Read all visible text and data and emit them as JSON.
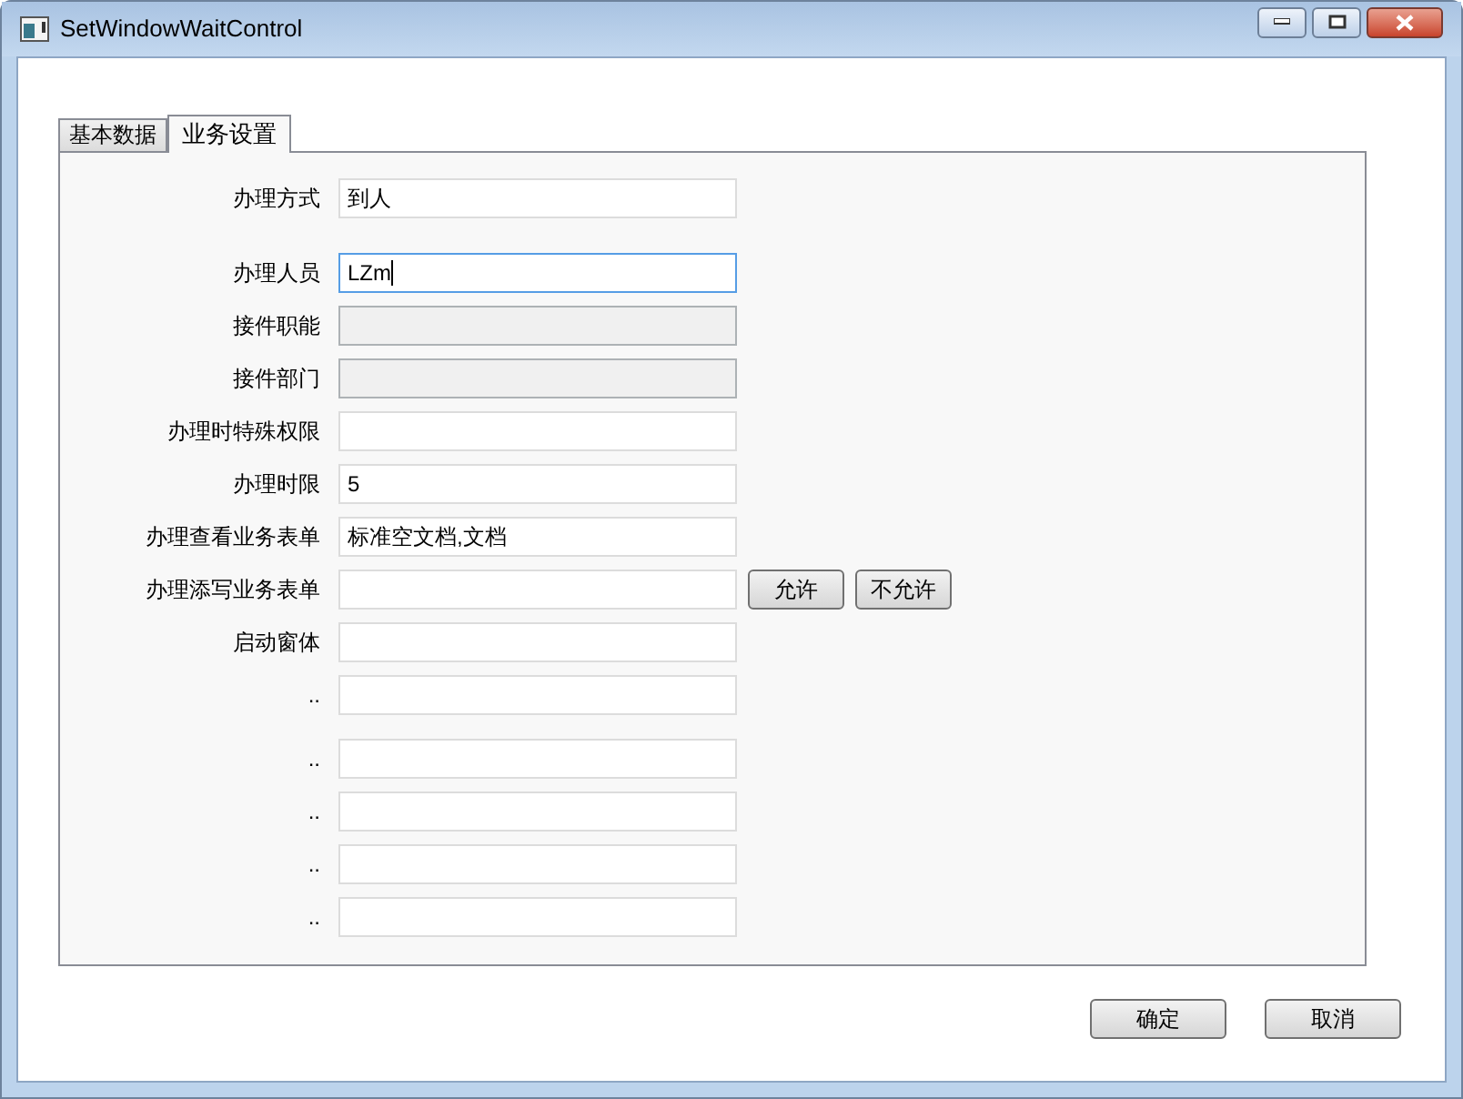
{
  "window": {
    "title": "SetWindowWaitControl"
  },
  "tabs": [
    {
      "label": "基本数据",
      "selected": false
    },
    {
      "label": "业务设置",
      "selected": true
    }
  ],
  "rows": [
    {
      "label": "办理方式",
      "value": "到人",
      "disabled": false,
      "focused": false
    },
    {
      "label": "办理人员",
      "value": "LZm",
      "disabled": false,
      "focused": true
    },
    {
      "label": "接件职能",
      "disabled": true,
      "focused": false
    },
    {
      "label": "接件部门",
      "disabled": true,
      "focused": false
    },
    {
      "label": "办理时特殊权限",
      "disabled": false,
      "focused": false
    },
    {
      "label": "办理时限",
      "value": "5",
      "disabled": false,
      "focused": false
    },
    {
      "label": "办理查看业务表单",
      "value": "标准空文档,文档",
      "disabled": false,
      "focused": false
    },
    {
      "label": "办理添写业务表单",
      "disabled": false,
      "focused": false,
      "buttons": [
        "允许",
        "不允许"
      ]
    },
    {
      "label": "启动窗体",
      "disabled": false,
      "focused": false
    },
    {
      "label": "..",
      "disabled": false,
      "focused": false
    },
    {
      "label": "..",
      "disabled": false,
      "focused": false
    },
    {
      "label": "..",
      "disabled": false,
      "focused": false
    },
    {
      "label": "..",
      "disabled": false,
      "focused": false
    },
    {
      "label": "..",
      "disabled": false,
      "focused": false
    }
  ],
  "buttons": [
    "确定",
    "取消"
  ]
}
